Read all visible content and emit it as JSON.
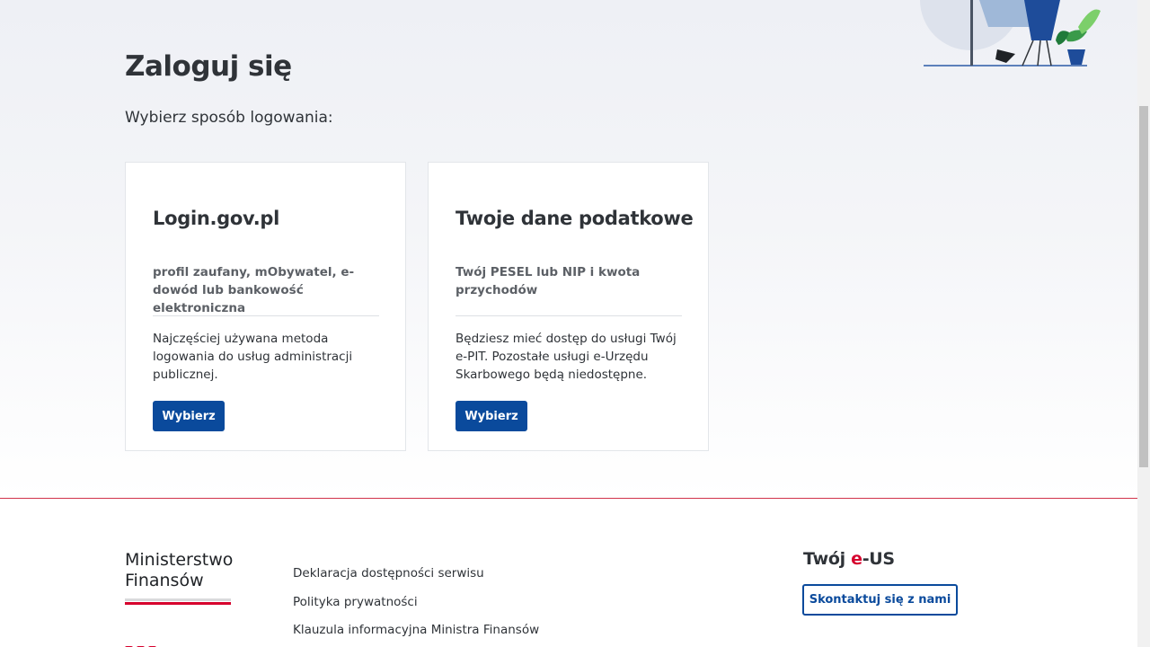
{
  "page": {
    "title": "Zaloguj się",
    "subtitle": "Wybierz sposób logowania:"
  },
  "cards": [
    {
      "title": "Login.gov.pl",
      "description": "profil zaufany, mObywatel, e-dowód lub bankowość elektroniczna",
      "text": "Najczęściej używana metoda logowania do usług administracji publicznej.",
      "button_label": "Wybierz"
    },
    {
      "title": "Twoje dane podatkowe",
      "description": "Twój PESEL lub NIP i kwota przychodów",
      "text": "Będziesz mieć dostęp do usługi Twój e-PIT. Pozostałe usługi e-Urzędu Skarbowego będą niedostępne.",
      "button_label": "Wybierz"
    }
  ],
  "footer": {
    "ministry_logo_text": [
      "Ministerstwo",
      "Finansów"
    ],
    "links": [
      "Deklaracja dostępności serwisu",
      "Polityka prywatności",
      "Klauzula informacyjna Ministra Finansów"
    ],
    "brand": {
      "prefix": "Twój ",
      "accent": "e",
      "suffix": "-US"
    },
    "contact_button": "Skontaktuj się z nami"
  },
  "colors": {
    "primary": "#0a4a9c",
    "accent_red": "#d6002d",
    "text": "#2f3338",
    "muted": "#5c6066"
  },
  "icons": [
    "office-chair-illustration",
    "plant-icon"
  ]
}
